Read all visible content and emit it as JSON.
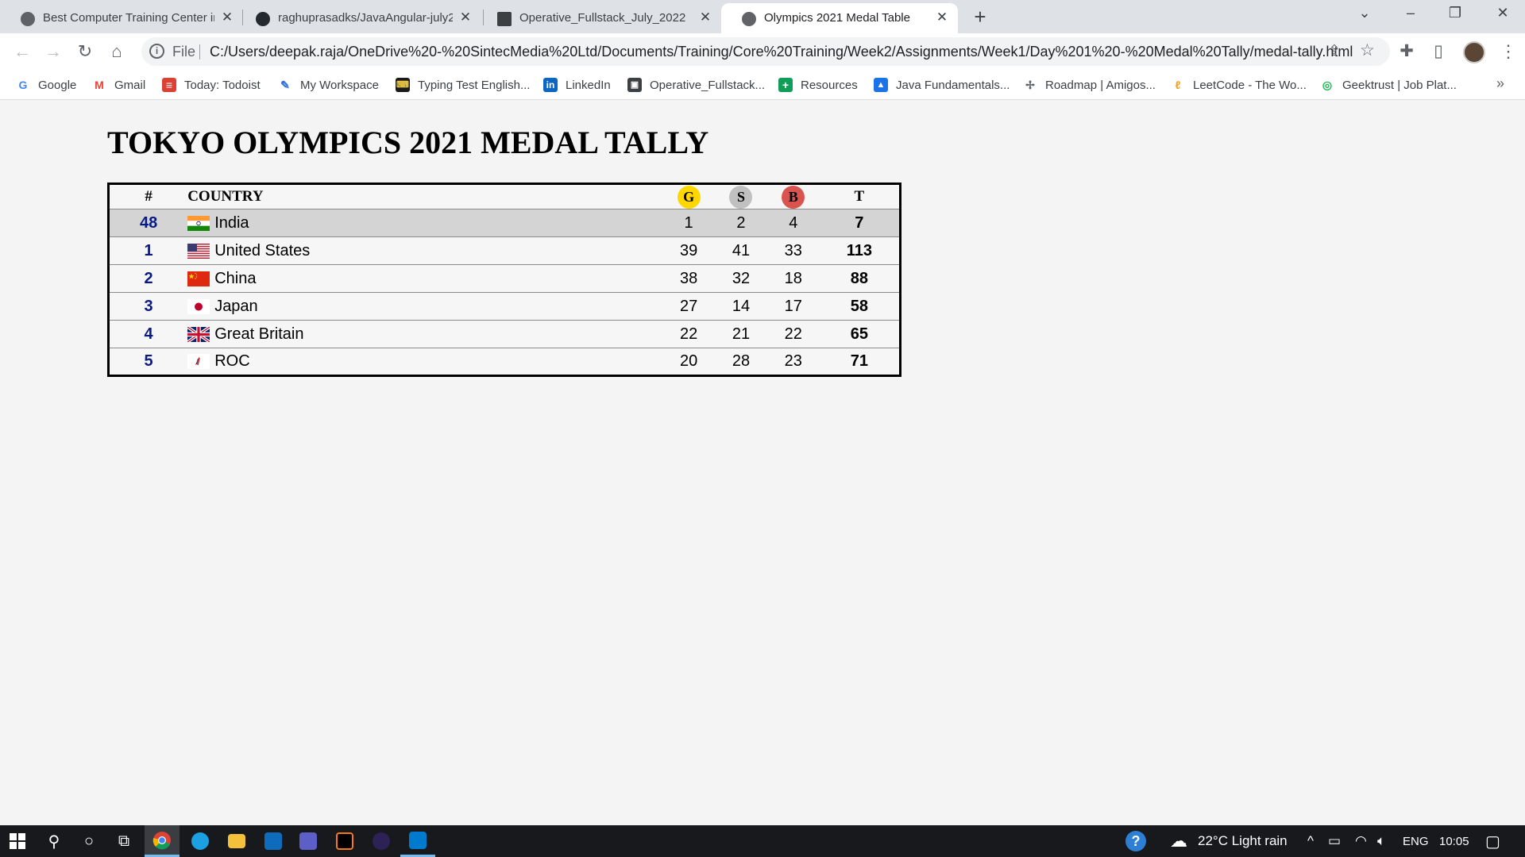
{
  "browser": {
    "tabs": [
      {
        "title": "Best Computer Training Center in",
        "active": false
      },
      {
        "title": "raghuprasadks/JavaAngular-july2",
        "active": false
      },
      {
        "title": "Operative_Fullstack_July_2022",
        "active": false
      },
      {
        "title": "Olympics 2021 Medal Table",
        "active": true
      }
    ],
    "new_tab": "+",
    "address": {
      "scheme": "File",
      "url": "C:/Users/deepak.raja/OneDrive%20-%20SintecMedia%20Ltd/Documents/Training/Core%20Training/Week2/Assignments/Week1/Day%201%20-%20Medal%20Tally/medal-tally.html"
    },
    "bookmarks": [
      {
        "label": "Google",
        "icon": "google-icon",
        "color": "#4285f4"
      },
      {
        "label": "Gmail",
        "icon": "gmail-icon",
        "color": "#ea4335"
      },
      {
        "label": "Today: Todoist",
        "icon": "todoist-icon",
        "color": "#db4035"
      },
      {
        "label": "My Workspace",
        "icon": "pen-icon",
        "color": "#2f6fdd"
      },
      {
        "label": "Typing Test English...",
        "icon": "typing-test-icon",
        "color": "#1a1a1a"
      },
      {
        "label": "LinkedIn",
        "icon": "linkedin-icon",
        "color": "#0a66c2"
      },
      {
        "label": "Operative_Fullstack...",
        "icon": "classroom-icon",
        "color": "#3c4043"
      },
      {
        "label": "Resources",
        "icon": "sheets-icon",
        "color": "#0f9d58"
      },
      {
        "label": "Java Fundamentals...",
        "icon": "classroom-user-icon",
        "color": "#1a73e8"
      },
      {
        "label": "Roadmap | Amigos...",
        "icon": "roadmap-icon",
        "color": "#5f6368"
      },
      {
        "label": "LeetCode - The Wo...",
        "icon": "leetcode-icon",
        "color": "#f89f1b"
      },
      {
        "label": "Geektrust | Job Plat...",
        "icon": "geektrust-icon",
        "color": "#1db954"
      }
    ],
    "more_bookmarks": "»"
  },
  "page": {
    "title": "TOKYO OLYMPICS 2021 MEDAL TALLY",
    "headers": {
      "rank": "#",
      "country": "COUNTRY",
      "gold": "G",
      "silver": "S",
      "bronze": "B",
      "total": "T"
    },
    "medal_colors": {
      "gold": "#ffd700",
      "silver": "#c0c0c0",
      "bronze": "#d9534f"
    },
    "highlight_color": "#d4d4d4",
    "rows": [
      {
        "rank": "48",
        "country": "India",
        "flag": "india-flag-icon",
        "gold": "1",
        "silver": "2",
        "bronze": "4",
        "total": "7",
        "highlight": true
      },
      {
        "rank": "1",
        "country": "United States",
        "flag": "usa-flag-icon",
        "gold": "39",
        "silver": "41",
        "bronze": "33",
        "total": "113",
        "highlight": false
      },
      {
        "rank": "2",
        "country": "China",
        "flag": "china-flag-icon",
        "gold": "38",
        "silver": "32",
        "bronze": "18",
        "total": "88",
        "highlight": false
      },
      {
        "rank": "3",
        "country": "Japan",
        "flag": "japan-flag-icon",
        "gold": "27",
        "silver": "14",
        "bronze": "17",
        "total": "58",
        "highlight": false
      },
      {
        "rank": "4",
        "country": "Great Britain",
        "flag": "uk-flag-icon",
        "gold": "22",
        "silver": "21",
        "bronze": "22",
        "total": "65",
        "highlight": false
      },
      {
        "rank": "5",
        "country": "ROC",
        "flag": "roc-flag-icon",
        "gold": "20",
        "silver": "28",
        "bronze": "23",
        "total": "71",
        "highlight": false
      }
    ]
  },
  "taskbar": {
    "weather": "22°C  Light rain",
    "language": "ENG",
    "time": "10:05"
  }
}
